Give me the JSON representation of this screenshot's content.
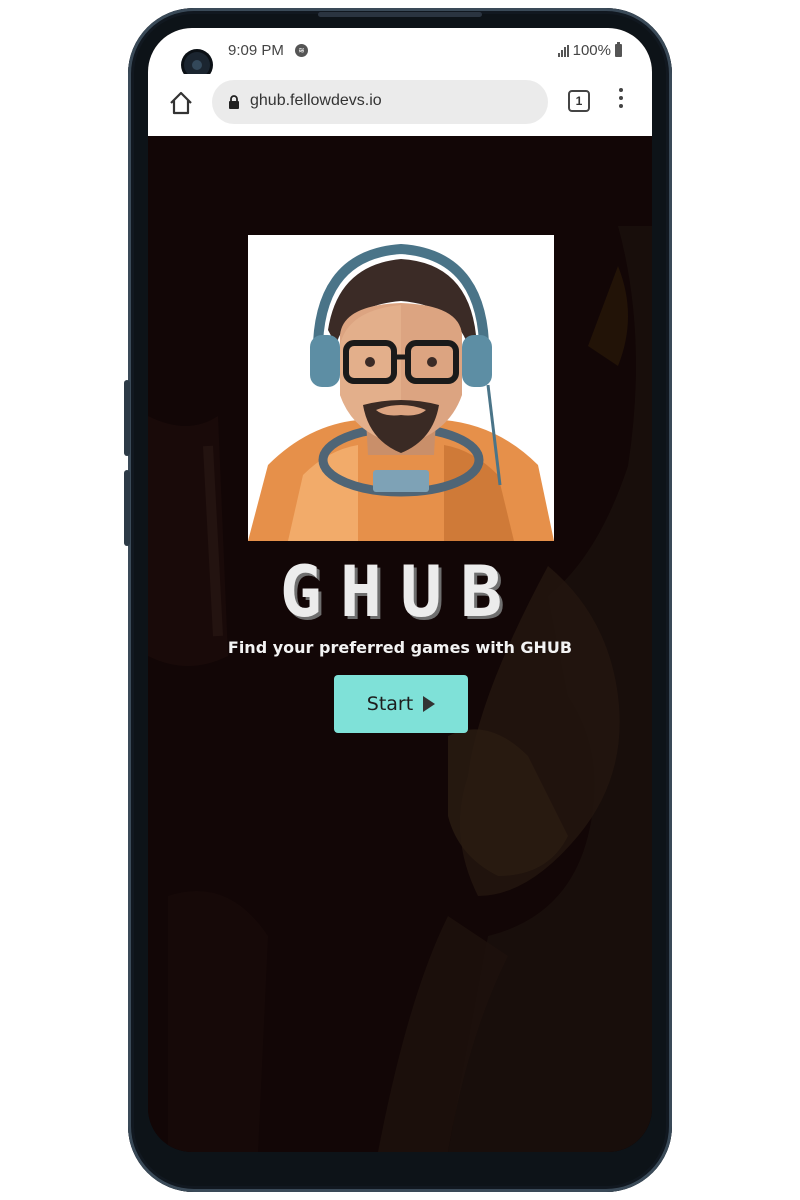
{
  "status_bar": {
    "time": "9:09 PM",
    "battery": "100%"
  },
  "browser": {
    "url": "ghub.fellowdevs.io",
    "tab_count": "1"
  },
  "hero": {
    "title": "GHUB",
    "tagline": "Find your preferred games with GHUB",
    "start_label": "Start"
  },
  "colors": {
    "accent": "#7fe1d8",
    "background": "#120606"
  },
  "icons": [
    "camera-icon",
    "spotify-icon",
    "signal-icon",
    "battery-icon",
    "home-icon",
    "lock-icon",
    "tabs-icon",
    "menu-icon",
    "play-icon"
  ]
}
